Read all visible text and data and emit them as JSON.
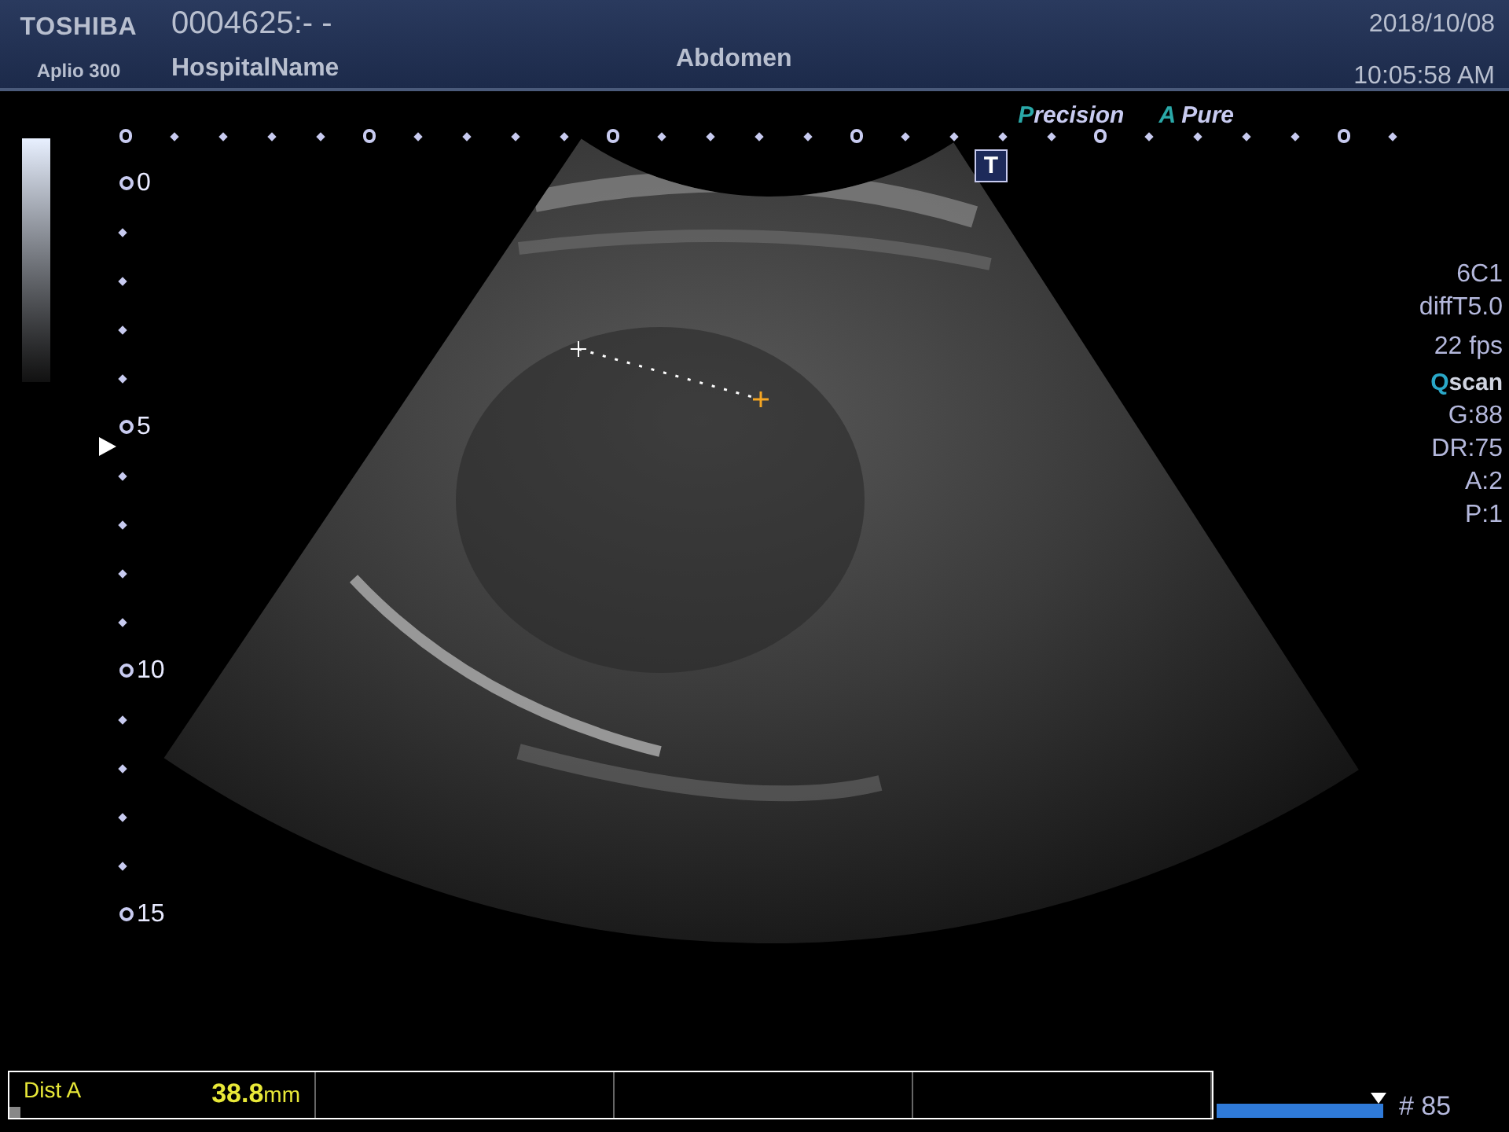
{
  "header": {
    "logo": "TOSHIBA",
    "model": "Aplio 300",
    "patient_id": "0004625:- -",
    "hospital": "HospitalName",
    "exam": "Abdomen",
    "date": "2018/10/08",
    "time": "10:05:58 AM"
  },
  "image_modes": [
    {
      "initial": "P",
      "rest": "recision"
    },
    {
      "initial": "A",
      "rest": " Pure"
    }
  ],
  "mode_badge": "T",
  "depth_scale": {
    "labels": [
      "0",
      "5",
      "10",
      "15"
    ]
  },
  "parameters": [
    {
      "kind": "text",
      "text": "6C1"
    },
    {
      "kind": "text",
      "text": "diffT5.0"
    },
    {
      "kind": "text",
      "text": "22 fps"
    },
    {
      "kind": "brand",
      "initial": "Q",
      "rest": "scan"
    },
    {
      "kind": "text",
      "text": "G:88"
    },
    {
      "kind": "text",
      "text": "DR:75"
    },
    {
      "kind": "text",
      "text": "A:2"
    },
    {
      "kind": "text",
      "text": "P:1"
    }
  ],
  "measurements": [
    {
      "label": "Dist A",
      "value": "38.8",
      "unit": "mm"
    }
  ],
  "cine": {
    "level": 1,
    "frame": "# 85"
  }
}
